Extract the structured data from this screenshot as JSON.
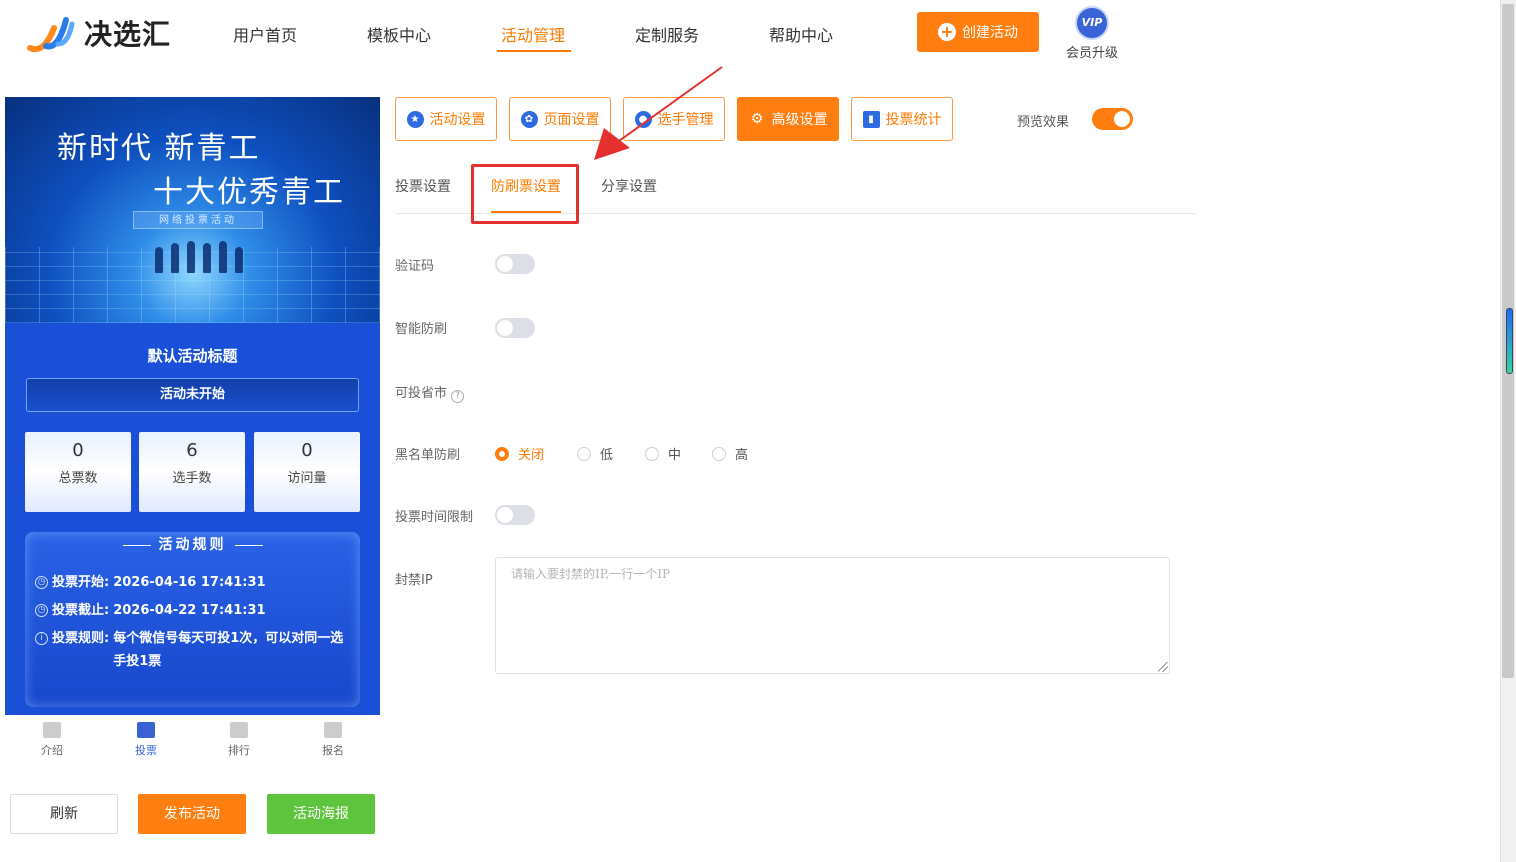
{
  "header": {
    "brand": "决选汇",
    "nav": [
      "用户首页",
      "模板中心",
      "活动管理",
      "定制服务",
      "帮助中心"
    ],
    "active_nav": "活动管理",
    "create_button": "创建活动",
    "vip_badge": "VIP",
    "vip_label": "会员升级"
  },
  "preview": {
    "banner_line1": "新时代 新青工",
    "banner_line2": "十大优秀青工",
    "banner_sub": "网络投票活动",
    "activity_title": "默认活动标题",
    "activity_status": "活动未开始",
    "stats": [
      {
        "value": "0",
        "label": "总票数"
      },
      {
        "value": "6",
        "label": "选手数"
      },
      {
        "value": "0",
        "label": "访问量"
      }
    ],
    "rules_title": "活动规则",
    "rules": [
      {
        "key": "投票开始:",
        "value": "2026-04-16 17:41:31",
        "icon": "clock-icon"
      },
      {
        "key": "投票截止:",
        "value": "2026-04-22 17:41:31",
        "icon": "clock-icon"
      },
      {
        "key": "投票规则:",
        "value": "每个微信号每天可投1次，可以对同一选手投1票",
        "icon": "info-icon"
      }
    ],
    "bottom_nav": [
      "介绍",
      "投票",
      "排行",
      "报名"
    ],
    "active_bottom_nav": "投票"
  },
  "actions": {
    "refresh": "刷新",
    "publish": "发布活动",
    "poster": "活动海报"
  },
  "toolbar": {
    "buttons": [
      "活动设置",
      "页面设置",
      "选手管理",
      "高级设置",
      "投票统计"
    ],
    "active": "高级设置",
    "preview_label": "预览效果",
    "preview_on": true
  },
  "subtabs": {
    "items": [
      "投票设置",
      "防刷票设置",
      "分享设置"
    ],
    "active": "防刷票设置"
  },
  "form": {
    "captcha_label": "验证码",
    "captcha_on": false,
    "smart_label": "智能防刷",
    "smart_on": false,
    "region_label": "可投省市",
    "blacklist_label": "黑名单防刷",
    "blacklist_options": [
      "关闭",
      "低",
      "中",
      "高"
    ],
    "blacklist_selected": "关闭",
    "time_limit_label": "投票时间限制",
    "time_limit_on": false,
    "ip_label": "封禁IP",
    "ip_value": "",
    "ip_placeholder": "请输入要封禁的IP,一行一个IP"
  },
  "colors": {
    "accent": "#ff7e0f",
    "annotation_red": "#e53030",
    "poster_green": "#5fc43d",
    "phone_blue": "#1a4fd8"
  }
}
